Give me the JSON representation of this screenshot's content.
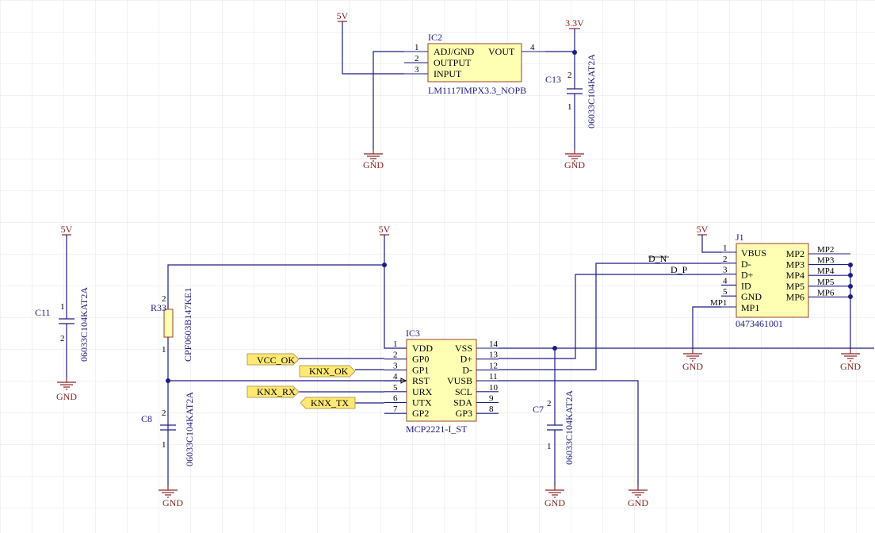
{
  "power": {
    "v5": "5V",
    "v33": "3.3V",
    "gnd": "GND"
  },
  "ic2": {
    "designator": "IC2",
    "comment": "LM1117IMPX3.3_NOPB",
    "pins": [
      {
        "num": "1",
        "name": "ADJ/GND"
      },
      {
        "num": "2",
        "name": "OUTPUT"
      },
      {
        "num": "3",
        "name": "INPUT"
      },
      {
        "num": "4",
        "name": "VOUT"
      }
    ]
  },
  "ic3": {
    "designator": "IC3",
    "comment": "MCP2221-I_ST",
    "left_pins": [
      {
        "num": "1",
        "name": "VDD"
      },
      {
        "num": "2",
        "name": "GP0"
      },
      {
        "num": "3",
        "name": "GP1"
      },
      {
        "num": "4",
        "name": "RST"
      },
      {
        "num": "5",
        "name": "URX"
      },
      {
        "num": "6",
        "name": "UTX"
      },
      {
        "num": "7",
        "name": "GP2"
      }
    ],
    "right_pins": [
      {
        "num": "14",
        "name": "VSS"
      },
      {
        "num": "13",
        "name": "D+"
      },
      {
        "num": "12",
        "name": "D-"
      },
      {
        "num": "11",
        "name": "VUSB"
      },
      {
        "num": "10",
        "name": "SCL"
      },
      {
        "num": "9",
        "name": "SDA"
      },
      {
        "num": "8",
        "name": "GP3"
      }
    ]
  },
  "j1": {
    "designator": "J1",
    "comment": "0473461001",
    "left_pins": [
      {
        "num": "1",
        "name": "VBUS"
      },
      {
        "num": "2",
        "name": "D-"
      },
      {
        "num": "3",
        "name": "D+"
      },
      {
        "num": "4",
        "name": "ID"
      },
      {
        "num": "5",
        "name": "GND"
      },
      {
        "num": "MP1",
        "name": "MP1"
      }
    ],
    "right_pins": [
      {
        "num": "MP2",
        "name": "MP2"
      },
      {
        "num": "MP3",
        "name": "MP3"
      },
      {
        "num": "MP4",
        "name": "MP4"
      },
      {
        "num": "MP5",
        "name": "MP5"
      },
      {
        "num": "MP6",
        "name": "MP6"
      }
    ]
  },
  "caps": {
    "c13": {
      "designator": "C13",
      "value": "06033C104KAT2A"
    },
    "c11": {
      "designator": "C11",
      "value": "06033C104KAT2A"
    },
    "c8": {
      "designator": "C8",
      "value": "06033C104KAT2A"
    },
    "c7": {
      "designator": "C7",
      "value": "06033C104KAT2A"
    }
  },
  "r33": {
    "designator": "R33",
    "value": "CPF0603B147KE1"
  },
  "passive_pins": {
    "p1": "1",
    "p2": "2"
  },
  "nets": {
    "d_n": "D_N",
    "d_p": "D_P"
  },
  "ports": {
    "vcc_ok": "VCC_OK",
    "knx_ok": "KNX_OK",
    "knx_rx": "KNX_RX",
    "knx_tx": "KNX_TX"
  },
  "colors": {
    "wire": "#1c1c86",
    "power": "#8c2323",
    "body": "#ffffb4",
    "port": "#ffe873"
  }
}
